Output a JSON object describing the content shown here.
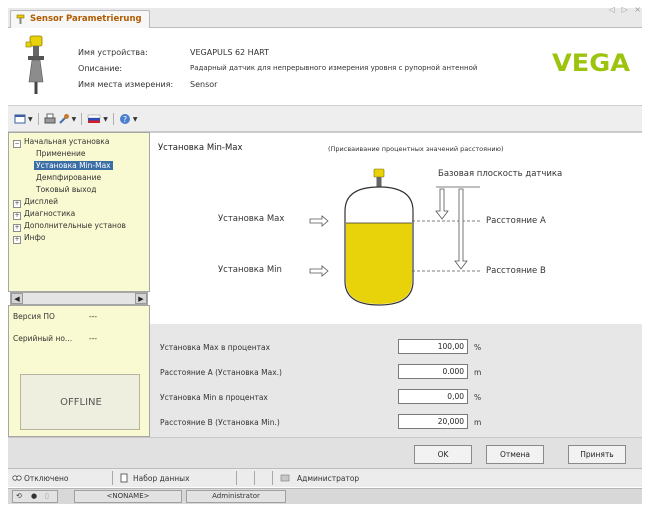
{
  "tab": {
    "title": "Sensor Parametrierung",
    "nav_arrows": "◁ ▷ ×"
  },
  "device": {
    "name_label": "Имя устройства:",
    "name_value": "VEGAPULS 62 HART",
    "desc_label": "Описание:",
    "desc_value": "Радарный датчик для непрерывного измерения уровня с рупорной антенной",
    "location_label": "Имя места измерения:",
    "location_value": "Sensor",
    "brand": "VEGA"
  },
  "toolbar": {
    "icons": [
      "window-icon",
      "print-icon",
      "tool-icon",
      "flag-icon",
      "help-icon"
    ]
  },
  "tree": {
    "items": [
      {
        "label": "Начальная установка",
        "pm": "−"
      },
      {
        "label": "Применение"
      },
      {
        "label": "Установка Min-Max"
      },
      {
        "label": "Демпфирование"
      },
      {
        "label": "Токовый выход"
      },
      {
        "label": "Дисплей",
        "pm": "+"
      },
      {
        "label": "Диагностика",
        "pm": "+"
      },
      {
        "label": "Дополнительные установ",
        "pm": "+"
      },
      {
        "label": "Инфо",
        "pm": "+"
      }
    ]
  },
  "info": {
    "software_label": "Версия ПО",
    "software_value": "---",
    "serial_label": "Серийный но...",
    "serial_value": "---",
    "offline": "OFFLINE"
  },
  "main": {
    "title": "Установка Min-Max",
    "note": "(Присваивание процентных значений расстоянию)",
    "base_plane": "Базовая плоскость датчика",
    "set_max": "Установка Max",
    "set_min": "Установка Min",
    "distance_a": "Расстояние A",
    "distance_b": "Расстояние B",
    "fields": [
      {
        "label": "Установка Max в процентах",
        "value": "100,00",
        "unit": "%"
      },
      {
        "label": "Расстояние A (Установка Max.)",
        "value": "0.000",
        "unit": "m"
      },
      {
        "label": "Установка Min в процентах",
        "value": "0,00",
        "unit": "%"
      },
      {
        "label": "Расстояние B (Установка Min.)",
        "value": "20,000",
        "unit": "m"
      }
    ]
  },
  "buttons": {
    "ok": "OK",
    "cancel": "Отмена",
    "apply": "Принять"
  },
  "status": {
    "connection": "Отключено",
    "dataset": "Набор данных",
    "role": "Администратор",
    "device_name": "<NONAME>",
    "user": "Administrator"
  },
  "colors": {
    "tree_bg": "#fafad2",
    "selection": "#3a6ea5",
    "tank_fill": "#e8d20a",
    "brand": "#9cc40f"
  }
}
